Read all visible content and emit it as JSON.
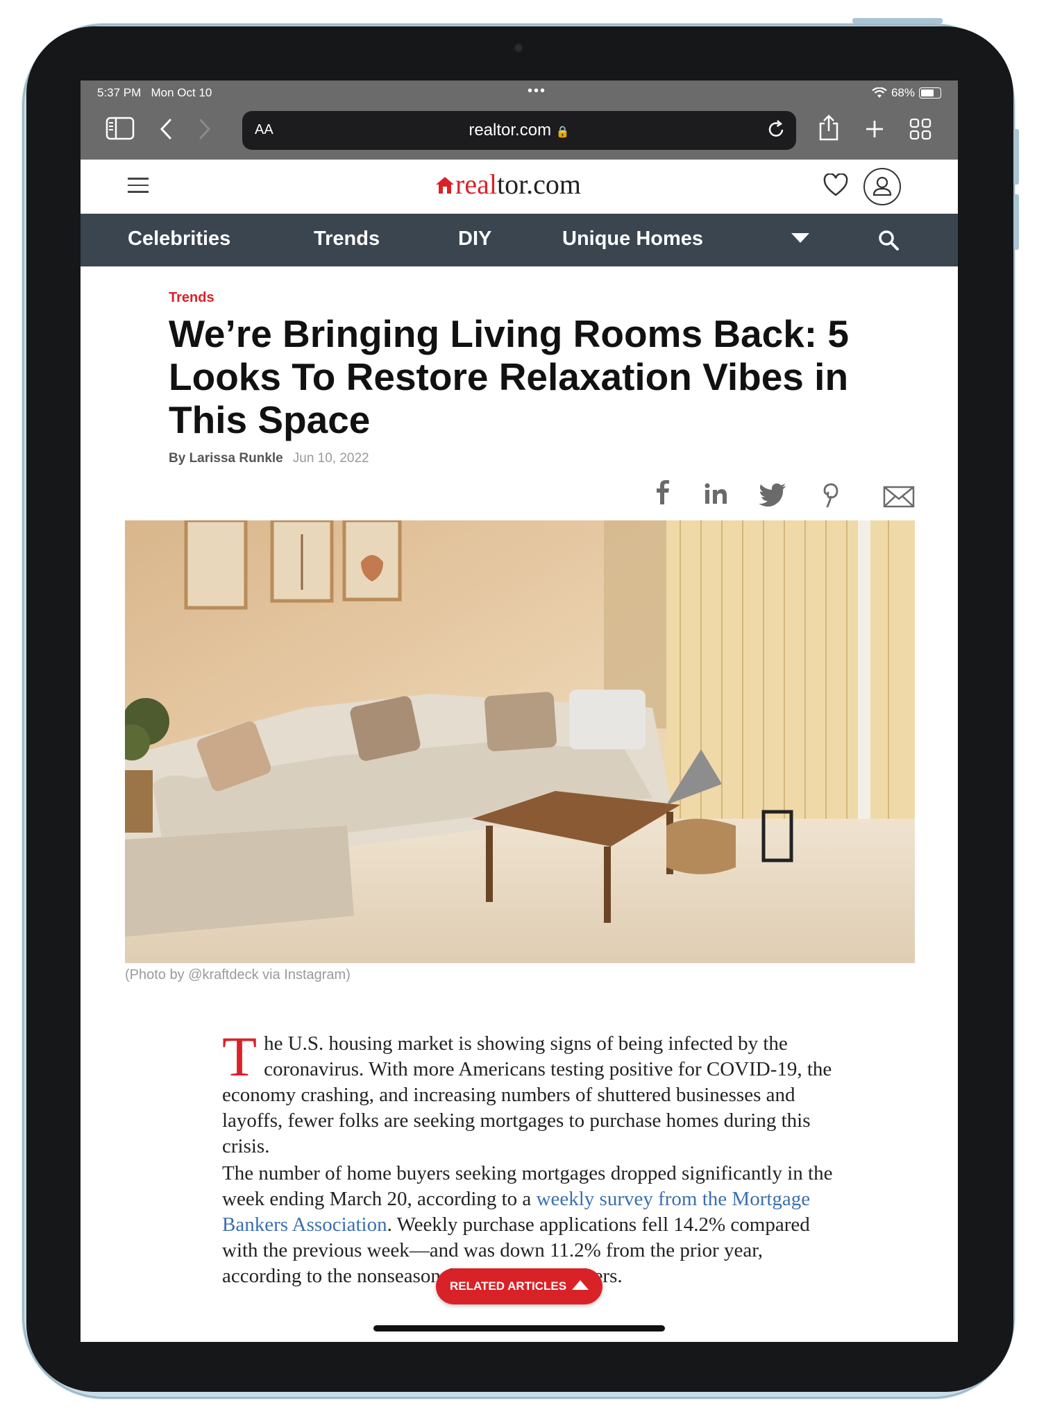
{
  "status_bar": {
    "time": "5:37 PM",
    "date": "Mon Oct 10",
    "dots": "•••",
    "battery": "68%"
  },
  "safari": {
    "text_size_label": "AA",
    "url": "realtor.com",
    "lock": "🔒"
  },
  "site": {
    "logo_real": "real",
    "logo_rest": "tor.com",
    "nav": [
      "Celebrities",
      "Trends",
      "DIY",
      "Unique Homes"
    ]
  },
  "article": {
    "kicker": "Trends",
    "headline": "We’re Bringing Living Rooms Back: 5 Looks To Restore Relaxation Vibes in This Space",
    "author": "By Larissa Runkle",
    "date": "Jun 10, 2022",
    "photo_caption": "(Photo by @kraftdeck via Instagram)",
    "dropcap": "T",
    "para1": "he U.S. housing market is showing signs of being infected by the coronavirus. With more Americans testing positive for COVID-19, the economy crashing, and increasing numbers of shuttered businesses and layoffs, fewer folks are seeking mortgages to purchase homes during this crisis.",
    "para2_start": "The number of home buyers seeking mortgages dropped significantly in the week ending March 20, according to a ",
    "para2_link": "weekly survey from the Mortgage Bankers Association",
    "para2_end": ". Weekly purchase applications fell 14.2% compared with the previous week—and was down 11.2% from the prior year, according to the nonseasonally adjusted numbers."
  },
  "related_button": "RELATED ARTICLES"
}
